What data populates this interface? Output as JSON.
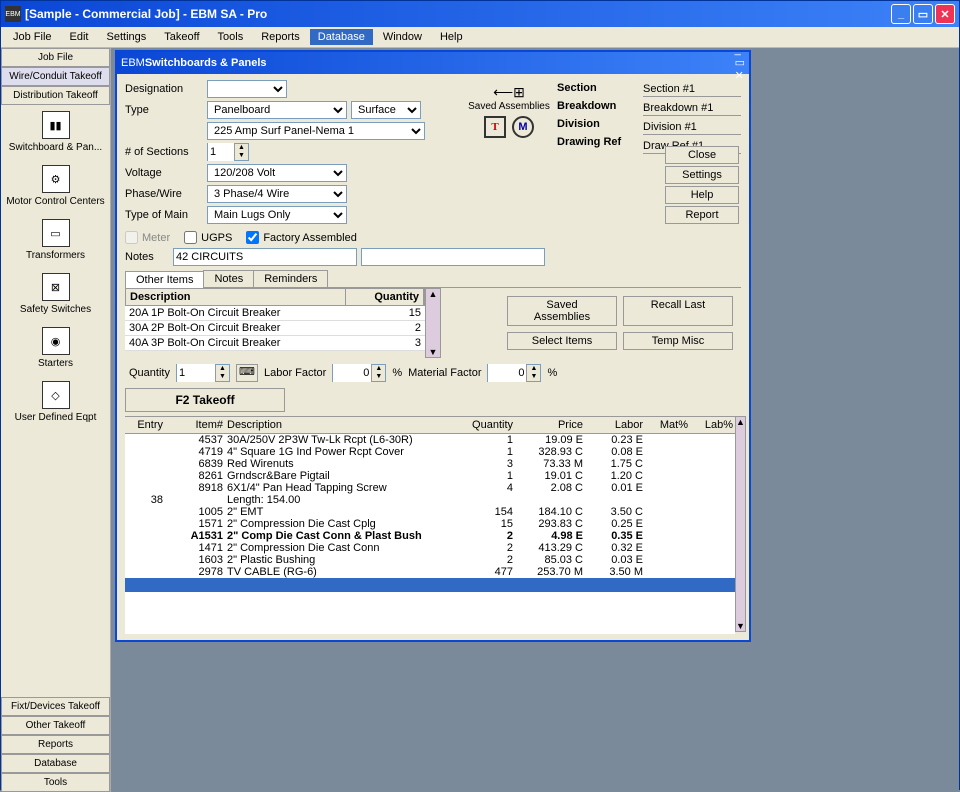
{
  "app_title": "[Sample - Commercial Job] - EBM SA  - Pro",
  "menubar": [
    "Job File",
    "Edit",
    "Settings",
    "Takeoff",
    "Tools",
    "Reports",
    "Database",
    "Window",
    "Help"
  ],
  "menubar_selected": 6,
  "left_nav_top": [
    "Job File",
    "Wire/Conduit Takeoff",
    "Distribution Takeoff"
  ],
  "left_nav_tools": [
    "Switchboard & Pan...",
    "Motor Control Centers",
    "Transformers",
    "Safety Switches",
    "Starters",
    "User Defined Eqpt"
  ],
  "left_nav_bottom": [
    "Fixt/Devices Takeoff",
    "Other Takeoff",
    "Reports",
    "Database",
    "Tools"
  ],
  "child_title": "Switchboards & Panels",
  "form": {
    "designation_label": "Designation",
    "designation": "",
    "type_label": "Type",
    "type": "Panelboard",
    "mount": "Surface",
    "model": "225 Amp Surf Panel-Nema 1",
    "sections_label": "# of Sections",
    "sections": "1",
    "voltage_label": "Voltage",
    "voltage": "120/208 Volt",
    "phase_label": "Phase/Wire",
    "phase": "3 Phase/4 Wire",
    "main_label": "Type of Main",
    "main": "Main Lugs Only"
  },
  "saved_label": "Saved Assemblies",
  "t_icon": "T",
  "m_icon": "M",
  "section_labels": {
    "section": "Section",
    "breakdown": "Breakdown",
    "division": "Division",
    "drawing": "Drawing Ref"
  },
  "section_vals": {
    "section": "Section #1",
    "breakdown": "Breakdown #1",
    "division": "Division #1",
    "drawing": "Draw Ref #1"
  },
  "side_btns": [
    "Close",
    "Settings",
    "Help",
    "Report"
  ],
  "checks": {
    "meter": "Meter",
    "ugps": "UGPS",
    "factory": "Factory Assembled",
    "factory_checked": true
  },
  "notes_label": "Notes",
  "notes_value": "42 CIRCUITS",
  "tabs": [
    "Other Items",
    "Notes",
    "Reminders"
  ],
  "other_items_head": {
    "desc": "Description",
    "qty": "Quantity"
  },
  "other_items": [
    {
      "desc": "20A 1P Bolt-On Circuit Breaker",
      "qty": "15"
    },
    {
      "desc": "30A 2P Bolt-On Circuit Breaker",
      "qty": "2"
    },
    {
      "desc": "40A 3P Bolt-On Circuit Breaker",
      "qty": "3"
    }
  ],
  "mid_btns": {
    "saved": "Saved Assemblies",
    "recall": "Recall Last",
    "select": "Select Items",
    "temp": "Temp Misc"
  },
  "qty_row": {
    "qty_label": "Quantity",
    "qty": "1",
    "lf_label": "Labor Factor",
    "lf": "0",
    "mf_label": "Material Factor",
    "mf": "0",
    "pct": "%"
  },
  "f2": "F2 Takeoff",
  "result_head": {
    "entry": "Entry",
    "item": "Item#",
    "desc": "Description",
    "qty": "Quantity",
    "price": "Price",
    "labor": "Labor",
    "mat": "Mat%",
    "lab": "Lab%"
  },
  "results": [
    {
      "entry": "",
      "item": "4537",
      "desc": "30A/250V 2P3W Tw-Lk Rcpt (L6-30R)",
      "qty": "1",
      "price": "19.09 E",
      "labor": "0.23 E",
      "bold": false
    },
    {
      "entry": "",
      "item": "4719",
      "desc": "4\" Square 1G Ind Power Rcpt Cover",
      "qty": "1",
      "price": "328.93 C",
      "labor": "0.08 E",
      "bold": false
    },
    {
      "entry": "",
      "item": "6839",
      "desc": "Red Wirenuts",
      "qty": "3",
      "price": "73.33 M",
      "labor": "1.75 C",
      "bold": false
    },
    {
      "entry": "",
      "item": "8261",
      "desc": "Grndscr&Bare Pigtail",
      "qty": "1",
      "price": "19.01 C",
      "labor": "1.20 C",
      "bold": false
    },
    {
      "entry": "",
      "item": "8918",
      "desc": "6X1/4\" Pan Head Tapping Screw",
      "qty": "4",
      "price": "2.08 C",
      "labor": "0.01 E",
      "bold": false
    },
    {
      "entry": "",
      "item": "",
      "desc": "",
      "qty": "",
      "price": "",
      "labor": "",
      "bold": false
    },
    {
      "entry": "38",
      "item": "",
      "desc": "Length: 154.00",
      "qty": "",
      "price": "",
      "labor": "",
      "bold": false
    },
    {
      "entry": "",
      "item": "1005",
      "desc": "2\" EMT",
      "qty": "154",
      "price": "184.10 C",
      "labor": "3.50 C",
      "bold": false
    },
    {
      "entry": "",
      "item": "1571",
      "desc": "2\" Compression Die Cast Cplg",
      "qty": "15",
      "price": "293.83 C",
      "labor": "0.25 E",
      "bold": false
    },
    {
      "entry": "",
      "item": "A1531",
      "desc": "2\" Comp Die Cast Conn & Plast Bush",
      "qty": "2",
      "price": "4.98 E",
      "labor": "0.35 E",
      "bold": true
    },
    {
      "entry": "",
      "item": "1471",
      "desc": "2\" Compression Die Cast Conn",
      "qty": "2",
      "price": "413.29 C",
      "labor": "0.32 E",
      "bold": false
    },
    {
      "entry": "",
      "item": "1603",
      "desc": "2\" Plastic Bushing",
      "qty": "2",
      "price": "85.03 C",
      "labor": "0.03 E",
      "bold": false
    },
    {
      "entry": "",
      "item": "2978",
      "desc": "TV CABLE (RG-6)",
      "qty": "477",
      "price": "253.70 M",
      "labor": "3.50 M",
      "bold": false
    }
  ]
}
